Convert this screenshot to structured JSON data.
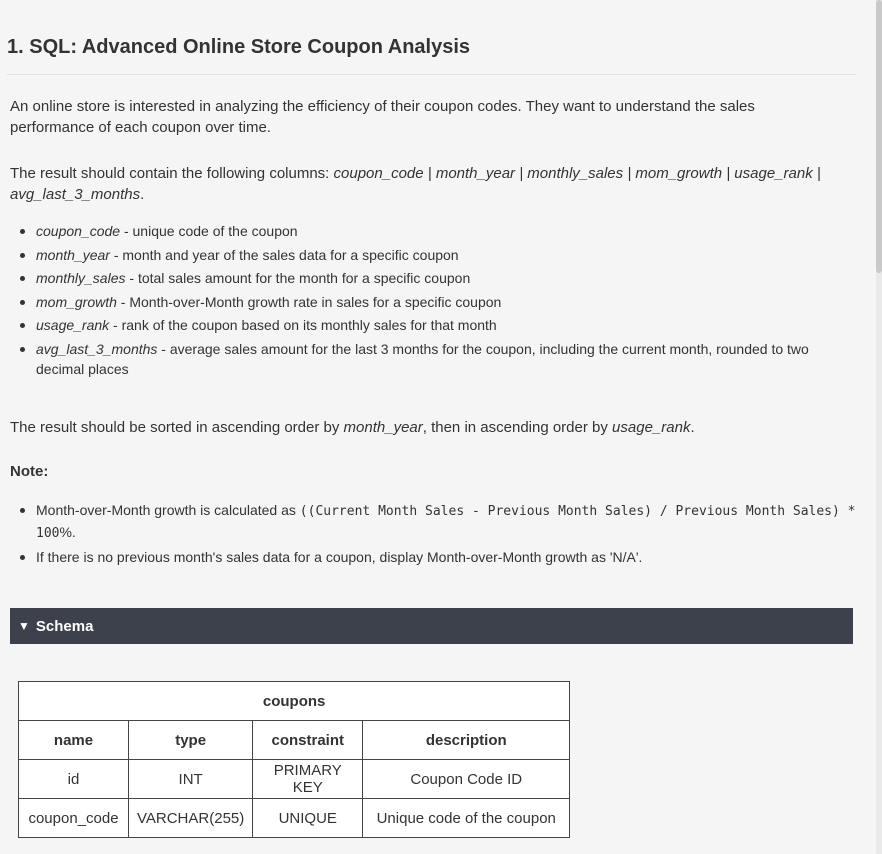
{
  "title": "1. SQL: Advanced Online Store Coupon Analysis",
  "intro": "An online store is interested in analyzing the efficiency of their coupon codes. They want to understand the sales performance of each coupon over time.",
  "columns_sentence": {
    "prefix": "The result should contain the following columns: ",
    "columns_italic": "coupon_code | month_year | monthly_sales | mom_growth | usage_rank | avg_last_3_months",
    "suffix": "."
  },
  "column_defs": [
    {
      "name": "coupon_code",
      "desc": " - unique code of the coupon"
    },
    {
      "name": "month_year",
      "desc": " - month and year of the sales data for a specific coupon"
    },
    {
      "name": "monthly_sales",
      "desc": " - total sales amount for the month for a specific coupon"
    },
    {
      "name": "mom_growth",
      "desc": " - Month-over-Month growth rate in sales for a specific coupon"
    },
    {
      "name": "usage_rank",
      "desc": " - rank of the coupon based on its monthly sales for that month"
    },
    {
      "name": "avg_last_3_months",
      "desc": " - average sales amount for the last 3 months for the coupon, including the current month, rounded to two decimal places"
    }
  ],
  "sort_sentence": {
    "part1": "The result should be sorted in ascending order by ",
    "field1": "month_year",
    "part2": ", then in ascending order by ",
    "field2": "usage_rank",
    "part3": "."
  },
  "note": {
    "title": "Note:",
    "item1_prefix": "Month-over-Month growth is calculated as ",
    "item1_code": "((Current Month Sales - Previous Month Sales) / Previous Month Sales) * 100",
    "item1_suffix": "%.",
    "item2": "If there is no previous month's sales data for a coupon, display Month-over-Month growth as 'N/A'."
  },
  "schema": {
    "toggle_label": "Schema",
    "toggle_icon": "triangle-down-icon",
    "table_name": "coupons",
    "headers": [
      "name",
      "type",
      "constraint",
      "description"
    ],
    "rows": [
      [
        "id",
        "INT",
        "PRIMARY KEY",
        "Coupon Code ID"
      ],
      [
        "coupon_code",
        "VARCHAR(255)",
        "UNIQUE",
        "Unique code of the coupon"
      ]
    ]
  },
  "colors": {
    "schema_bar": "#3c414c",
    "text": "#333333",
    "background": "#f5f5f5"
  }
}
